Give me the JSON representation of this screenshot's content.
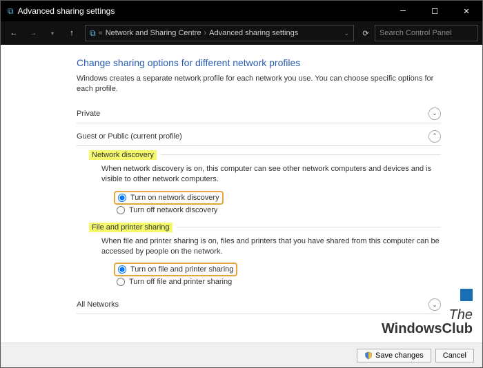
{
  "titlebar": {
    "title": "Advanced sharing settings"
  },
  "nav": {
    "crumb1": "Network and Sharing Centre",
    "crumb2": "Advanced sharing settings",
    "search_placeholder": "Search Control Panel"
  },
  "page": {
    "title": "Change sharing options for different network profiles",
    "desc": "Windows creates a separate network profile for each network you use. You can choose specific options for each profile."
  },
  "sections": {
    "private": "Private",
    "guest": "Guest or Public (current profile)",
    "all": "All Networks"
  },
  "netdisc": {
    "heading": "Network discovery",
    "desc": "When network discovery is on, this computer can see other network computers and devices and is visible to other network computers.",
    "on": "Turn on network discovery",
    "off": "Turn off network discovery"
  },
  "fileprint": {
    "heading": "File and printer sharing",
    "desc": "When file and printer sharing is on, files and printers that you have shared from this computer can be accessed by people on the network.",
    "on": "Turn on file and printer sharing",
    "off": "Turn off file and printer sharing"
  },
  "buttons": {
    "save": "Save changes",
    "cancel": "Cancel"
  },
  "watermark": {
    "line1": "The",
    "line2": "WindowsClub"
  }
}
